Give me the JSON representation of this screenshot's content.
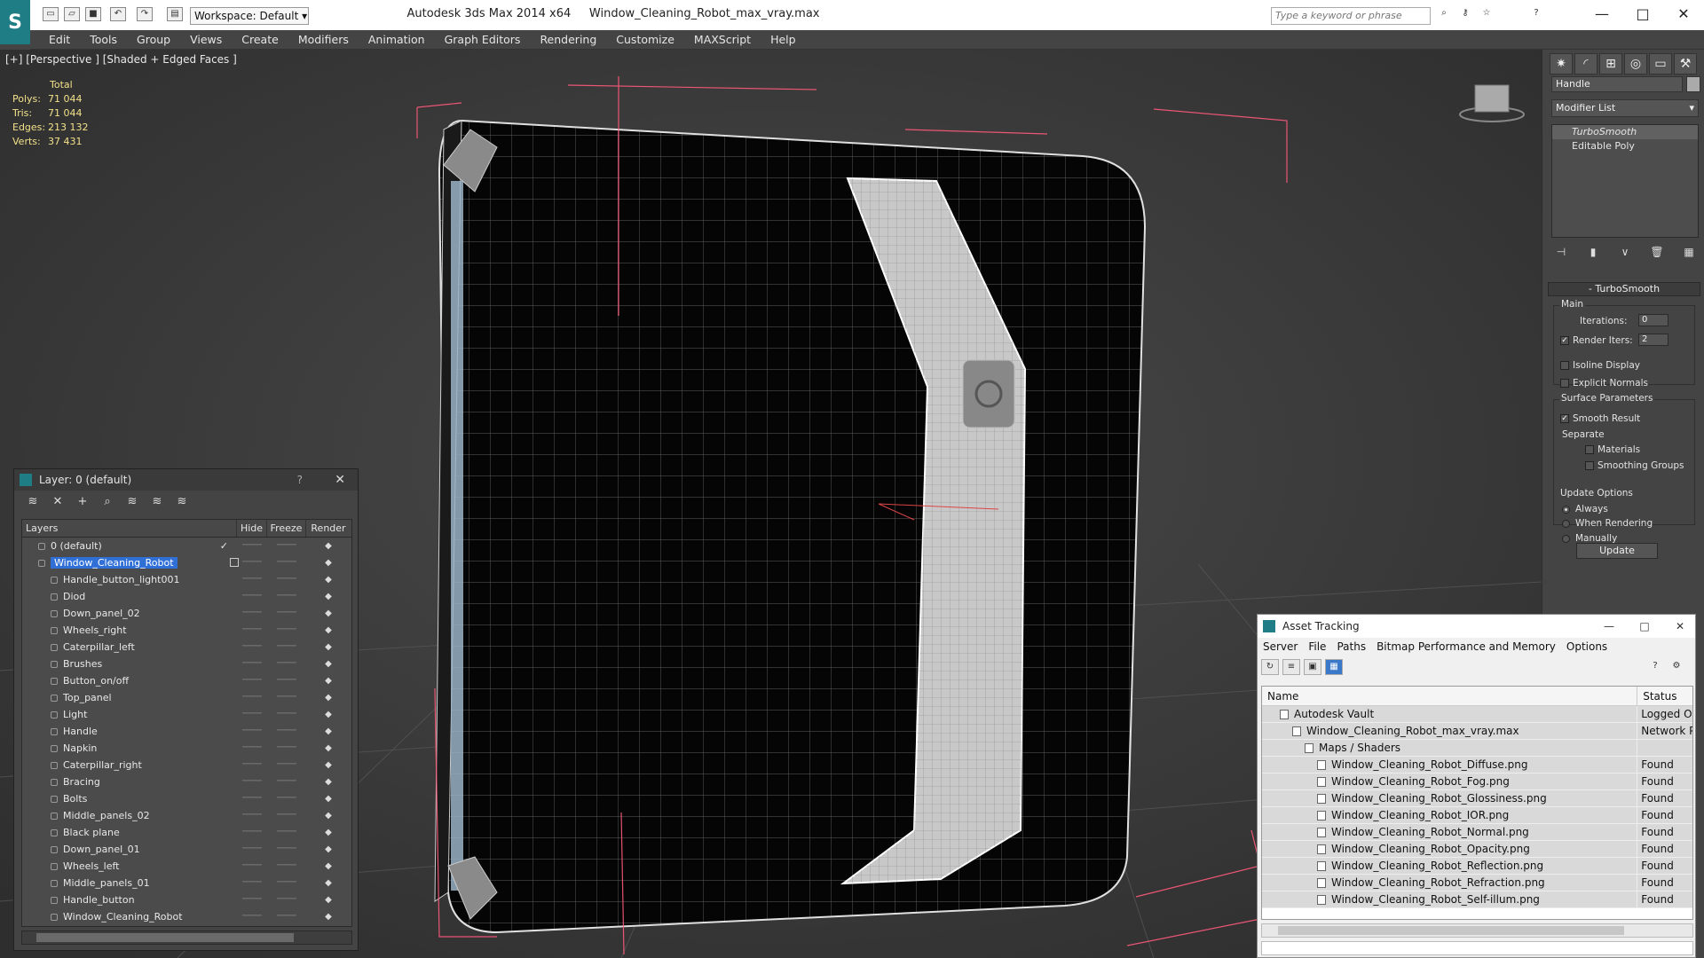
{
  "titlebar": {
    "app": "Autodesk 3ds Max  2014 x64",
    "file": "Window_Cleaning_Robot_max_vray.max",
    "workspace": "Workspace: Default",
    "search_placeholder": "Type a keyword or phrase"
  },
  "menu": [
    "Edit",
    "Tools",
    "Group",
    "Views",
    "Create",
    "Modifiers",
    "Animation",
    "Graph Editors",
    "Rendering",
    "Customize",
    "MAXScript",
    "Help"
  ],
  "viewport": {
    "label": "[+] [Perspective ] [Shaded + Edged Faces ]",
    "stats": {
      "header": "Total",
      "rows": [
        {
          "k": "Polys:",
          "v": "71 044"
        },
        {
          "k": "Tris:",
          "v": "71 044"
        },
        {
          "k": "Edges:",
          "v": "213 132"
        },
        {
          "k": "Verts:",
          "v": "37 431"
        }
      ]
    }
  },
  "command_panel": {
    "object_name": "Handle",
    "modifier_list": "Modifier List",
    "stack": [
      "TurboSmooth",
      "Editable Poly"
    ],
    "rollout": "TurboSmooth",
    "main": "Main",
    "iterations_label": "Iterations:",
    "iterations_value": "0",
    "render_iters_label": "Render Iters:",
    "render_iters_value": "2",
    "isoline": "Isoline Display",
    "explicit": "Explicit Normals",
    "surface_params": "Surface Parameters",
    "smooth_result": "Smooth Result",
    "separate": "Separate",
    "materials": "Materials",
    "smoothing_groups": "Smoothing Groups",
    "update_options": "Update Options",
    "always": "Always",
    "when_rendering": "When Rendering",
    "manually": "Manually",
    "update_btn": "Update"
  },
  "layer_window": {
    "title": "Layer: 0 (default)",
    "help": "?",
    "columns": [
      "Layers",
      "Hide",
      "Freeze",
      "Render"
    ],
    "rows": [
      "0 (default)",
      "Window_Cleaning_Robot",
      "Handle_button_light001",
      "Diod",
      "Down_panel_02",
      "Wheels_right",
      "Caterpillar_left",
      "Brushes",
      "Button_on/off",
      "Top_panel",
      "Light",
      "Handle",
      "Napkin",
      "Caterpillar_right",
      "Bracing",
      "Bolts",
      "Middle_panels_02",
      "Black plane",
      "Down_panel_01",
      "Wheels_left",
      "Middle_panels_01",
      "Handle_button",
      "Window_Cleaning_Robot"
    ]
  },
  "asset_window": {
    "title": "Asset Tracking",
    "menu": [
      "Server",
      "File",
      "Paths",
      "Bitmap Performance and Memory",
      "Options"
    ],
    "columns": [
      "Name",
      "Status"
    ],
    "rows": [
      {
        "name": "Autodesk Vault",
        "status": "Logged Ou"
      },
      {
        "name": "Window_Cleaning_Robot_max_vray.max",
        "status": "Network P..."
      },
      {
        "name": "Maps / Shaders",
        "status": ""
      },
      {
        "name": "Window_Cleaning_Robot_Diffuse.png",
        "status": "Found"
      },
      {
        "name": "Window_Cleaning_Robot_Fog.png",
        "status": "Found"
      },
      {
        "name": "Window_Cleaning_Robot_Glossiness.png",
        "status": "Found"
      },
      {
        "name": "Window_Cleaning_Robot_IOR.png",
        "status": "Found"
      },
      {
        "name": "Window_Cleaning_Robot_Normal.png",
        "status": "Found"
      },
      {
        "name": "Window_Cleaning_Robot_Opacity.png",
        "status": "Found"
      },
      {
        "name": "Window_Cleaning_Robot_Reflection.png",
        "status": "Found"
      },
      {
        "name": "Window_Cleaning_Robot_Refraction.png",
        "status": "Found"
      },
      {
        "name": "Window_Cleaning_Robot_Self-illum.png",
        "status": "Found"
      }
    ]
  }
}
